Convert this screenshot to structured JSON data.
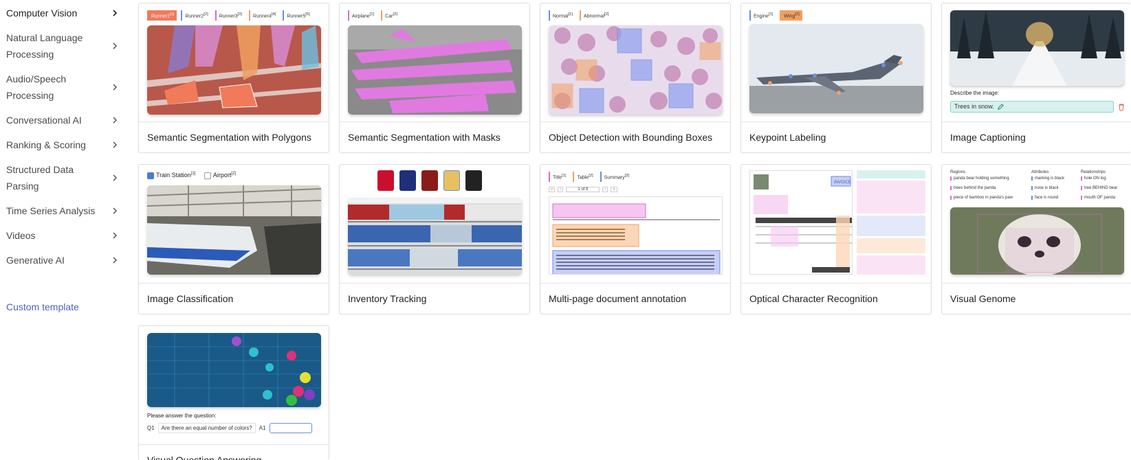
{
  "sidebar": {
    "items": [
      {
        "label": "Computer Vision"
      },
      {
        "label": "Natural Language Processing"
      },
      {
        "label": "Audio/Speech Processing"
      },
      {
        "label": "Conversational AI"
      },
      {
        "label": "Ranking & Scoring"
      },
      {
        "label": "Structured Data Parsing"
      },
      {
        "label": "Time Series Analysis"
      },
      {
        "label": "Videos"
      },
      {
        "label": "Generative AI"
      }
    ],
    "custom_template": "Custom template"
  },
  "cards": [
    {
      "title": "Semantic Segmentation with Polygons",
      "labels": [
        "Runner1",
        "Runner2",
        "Runner3",
        "Runner4",
        "Runner5"
      ],
      "counts": [
        "[1]",
        "[2]",
        "[3]",
        "[4]",
        "[5]"
      ]
    },
    {
      "title": "Semantic Segmentation with Masks",
      "labels": [
        "Airplane",
        "Car"
      ],
      "counts": [
        "[1]",
        "[2]"
      ]
    },
    {
      "title": "Object Detection with Bounding Boxes",
      "labels": [
        "Normal",
        "Abnormal"
      ],
      "counts": [
        "[1]",
        "[2]"
      ]
    },
    {
      "title": "Keypoint Labeling",
      "labels": [
        "Engine",
        "Wing"
      ],
      "counts": [
        "[1]",
        "[2]"
      ]
    },
    {
      "title": "Image Captioning",
      "question": "Describe the image:",
      "answer": "Trees in snow."
    },
    {
      "title": "Image Classification",
      "labels": [
        "Train Station",
        "Airport"
      ],
      "counts": [
        "[1]",
        "[2]"
      ]
    },
    {
      "title": "Inventory Tracking"
    },
    {
      "title": "Multi-page document annotation",
      "labels": [
        "Title",
        "Table",
        "Summary"
      ],
      "counts": [
        "[1]",
        "[2]",
        "[3]"
      ],
      "pager": "1 of 9"
    },
    {
      "title": "Optical Character Recognition",
      "invoice": "INVOICE"
    },
    {
      "title": "Visual Genome",
      "columns": [
        "Regions",
        "Attributes",
        "Relationships"
      ],
      "regions": [
        "panda bear holding something",
        "trees behind the panda",
        "piece of bamboo in panda's paw"
      ],
      "attributes": [
        "marking is black",
        "nose is black",
        "face is round"
      ],
      "relationships": [
        "hole ON log",
        "tree BEHIND bear",
        "mouth OF panda"
      ]
    },
    {
      "title": "Visual Question Answering",
      "question": "Please answer the question:",
      "q_label": "Q1",
      "q_text": "Are there an equal number of colors?",
      "a_label": "A1"
    }
  ],
  "colors": {
    "accent": "#4c63c6",
    "runner1": "#f07a5a",
    "tag_blue": "#6a8de0",
    "tag_pink": "#d86bd0",
    "tag_orange": "#f0a060"
  }
}
